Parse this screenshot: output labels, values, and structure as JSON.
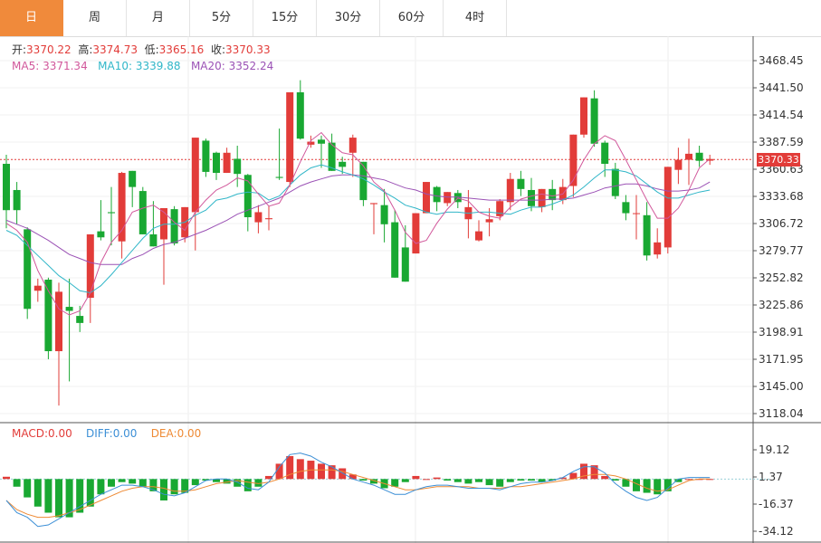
{
  "tabs": [
    "日",
    "周",
    "月",
    "5分",
    "15分",
    "30分",
    "60分",
    "4时"
  ],
  "active_tab": 0,
  "ohlc": {
    "open_label": "开:",
    "open": "3370.22",
    "high_label": "高:",
    "high": "3374.73",
    "low_label": "低:",
    "low": "3365.16",
    "close_label": "收:",
    "close": "3370.33"
  },
  "ma": {
    "ma5_label": "MA5:",
    "ma5": "3371.34",
    "ma10_label": "MA10:",
    "ma10": "3339.88",
    "ma20_label": "MA20:",
    "ma20": "3352.24"
  },
  "macd": {
    "macd_label": "MACD:",
    "macd": "0.00",
    "diff_label": "DIFF:",
    "diff": "0.00",
    "dea_label": "DEA:",
    "dea": "0.00"
  },
  "current_price": "3370.33",
  "colors": {
    "up": "#e23c39",
    "down": "#19a832",
    "ma5": "#d1589b",
    "ma10": "#30b6c8",
    "ma20": "#9b52b5",
    "diff": "#3c8fd6",
    "dea": "#ee8a34",
    "active_tab": "#f08a3b"
  },
  "chart_data": {
    "type": "candlestick",
    "y_ticks": [
      "3468.45",
      "3441.50",
      "3414.54",
      "3387.59",
      "3360.63",
      "3333.68",
      "3306.72",
      "3279.77",
      "3252.82",
      "3225.86",
      "3198.91",
      "3171.95",
      "3145.00",
      "3118.04"
    ],
    "ylim": [
      3118.04,
      3468.45
    ],
    "macd_ticks": [
      "19.12",
      "1.37",
      "-16.37",
      "-34.12"
    ],
    "macd_ylim": [
      -34.12,
      19.12
    ],
    "candles": [
      [
        3366,
        3375,
        3302,
        3320
      ],
      [
        3340,
        3348,
        3306,
        3320
      ],
      [
        3301,
        3303,
        3212,
        3222
      ],
      [
        3240,
        3252,
        3229,
        3245
      ],
      [
        3251,
        3253,
        3172,
        3180
      ],
      [
        3180,
        3248,
        3126,
        3239
      ],
      [
        3224,
        3252,
        3150,
        3220
      ],
      [
        3215,
        3225,
        3199,
        3208
      ],
      [
        3233,
        3276,
        3208,
        3296
      ],
      [
        3299,
        3330,
        3290,
        3293
      ],
      [
        3318,
        3343,
        3285,
        3317
      ],
      [
        3289,
        3358,
        3272,
        3357
      ],
      [
        3359,
        3356,
        3323,
        3343
      ],
      [
        3339,
        3343,
        3302,
        3296
      ],
      [
        3296,
        3329,
        3305,
        3284
      ],
      [
        3291,
        3319,
        3246,
        3322
      ],
      [
        3321,
        3324,
        3285,
        3287
      ],
      [
        3293,
        3317,
        3288,
        3323
      ],
      [
        3318,
        3391,
        3280,
        3392
      ],
      [
        3389,
        3391,
        3353,
        3358
      ],
      [
        3377,
        3378,
        3350,
        3357
      ],
      [
        3357,
        3382,
        3367,
        3377
      ],
      [
        3371,
        3384,
        3343,
        3356
      ],
      [
        3355,
        3356,
        3299,
        3313
      ],
      [
        3308,
        3325,
        3297,
        3318
      ],
      [
        3311,
        3324,
        3300,
        3312
      ],
      [
        3353,
        3401,
        3350,
        3352
      ],
      [
        3348,
        3415,
        3343,
        3437
      ],
      [
        3437,
        3449,
        3390,
        3391
      ],
      [
        3385,
        3394,
        3382,
        3388
      ],
      [
        3390,
        3394,
        3362,
        3386
      ],
      [
        3387,
        3396,
        3363,
        3359
      ],
      [
        3368,
        3373,
        3356,
        3363
      ],
      [
        3377,
        3395,
        3353,
        3392
      ],
      [
        3368,
        3366,
        3324,
        3330
      ],
      [
        3326,
        3326,
        3296,
        3327
      ],
      [
        3325,
        3341,
        3288,
        3306
      ],
      [
        3308,
        3320,
        3277,
        3253
      ],
      [
        3283,
        3305,
        3269,
        3249
      ],
      [
        3277,
        3316,
        3298,
        3317
      ],
      [
        3317,
        3342,
        3337,
        3348
      ],
      [
        3343,
        3344,
        3319,
        3328
      ],
      [
        3327,
        3336,
        3324,
        3338
      ],
      [
        3337,
        3340,
        3322,
        3328
      ],
      [
        3311,
        3340,
        3292,
        3323
      ],
      [
        3290,
        3310,
        3289,
        3299
      ],
      [
        3308,
        3322,
        3294,
        3311
      ],
      [
        3314,
        3331,
        3310,
        3329
      ],
      [
        3328,
        3357,
        3320,
        3351
      ],
      [
        3351,
        3359,
        3334,
        3341
      ],
      [
        3340,
        3352,
        3319,
        3324
      ],
      [
        3323,
        3339,
        3318,
        3341
      ],
      [
        3341,
        3350,
        3320,
        3330
      ],
      [
        3330,
        3351,
        3326,
        3343
      ],
      [
        3344,
        3378,
        3333,
        3395
      ],
      [
        3395,
        3431,
        3392,
        3432
      ],
      [
        3431,
        3439,
        3383,
        3386
      ],
      [
        3387,
        3389,
        3353,
        3366
      ],
      [
        3361,
        3367,
        3331,
        3334
      ],
      [
        3328,
        3335,
        3310,
        3317
      ],
      [
        3317,
        3335,
        3291,
        3317
      ],
      [
        3315,
        3328,
        3270,
        3275
      ],
      [
        3276,
        3302,
        3272,
        3288
      ],
      [
        3283,
        3358,
        3277,
        3363
      ],
      [
        3360,
        3382,
        3346,
        3370
      ],
      [
        3370,
        3391,
        3345,
        3376
      ],
      [
        3377,
        3384,
        3363,
        3369
      ],
      [
        3370,
        3375,
        3365,
        3370
      ]
    ],
    "ma5": [
      3307,
      3300,
      3288,
      3260,
      3240,
      3222,
      3216,
      3220,
      3238,
      3268,
      3288,
      3300,
      3318,
      3322,
      3325,
      3318,
      3308,
      3300,
      3318,
      3330,
      3340,
      3345,
      3352,
      3349,
      3336,
      3324,
      3327,
      3345,
      3368,
      3389,
      3397,
      3385,
      3377,
      3375,
      3364,
      3348,
      3339,
      3320,
      3298,
      3287,
      3290,
      3307,
      3321,
      3332,
      3329,
      3318,
      3314,
      3312,
      3323,
      3331,
      3334,
      3336,
      3334,
      3336,
      3350,
      3370,
      3386,
      3394,
      3389,
      3370,
      3350,
      3330,
      3312,
      3312,
      3322,
      3340,
      3362,
      3371
    ],
    "ma10": [
      3300,
      3295,
      3285,
      3275,
      3265,
      3255,
      3248,
      3240,
      3238,
      3245,
      3256,
      3268,
      3280,
      3292,
      3302,
      3306,
      3306,
      3308,
      3315,
      3320,
      3330,
      3332,
      3336,
      3338,
      3337,
      3330,
      3334,
      3345,
      3355,
      3362,
      3365,
      3362,
      3358,
      3355,
      3351,
      3345,
      3338,
      3332,
      3325,
      3322,
      3318,
      3316,
      3318,
      3318,
      3317,
      3318,
      3318,
      3317,
      3316,
      3320,
      3323,
      3323,
      3326,
      3330,
      3335,
      3343,
      3352,
      3360,
      3360,
      3358,
      3354,
      3346,
      3338,
      3332,
      3332,
      3335,
      3338,
      3340
    ],
    "ma20": [
      3310,
      3306,
      3302,
      3296,
      3290,
      3283,
      3276,
      3272,
      3268,
      3266,
      3266,
      3266,
      3272,
      3276,
      3282,
      3286,
      3288,
      3292,
      3296,
      3300,
      3305,
      3310,
      3316,
      3320,
      3324,
      3328,
      3332,
      3338,
      3344,
      3348,
      3351,
      3354,
      3355,
      3355,
      3354,
      3352,
      3350,
      3346,
      3342,
      3340,
      3336,
      3334,
      3333,
      3333,
      3332,
      3331,
      3330,
      3330,
      3330,
      3330,
      3330,
      3330,
      3331,
      3331,
      3332,
      3335,
      3338,
      3342,
      3344,
      3346,
      3346,
      3344,
      3341,
      3339,
      3339,
      3340,
      3342,
      3348
    ],
    "macd_hist": [
      1.5,
      -5,
      -12,
      -18,
      -22,
      -25,
      -25,
      -22,
      -18,
      -10,
      -5,
      -2,
      -3,
      -5,
      -8,
      -14,
      -10,
      -9,
      -4,
      -1,
      -2,
      -3,
      -5,
      -8,
      -5,
      2,
      10,
      15,
      13,
      12,
      10,
      9,
      7,
      3,
      -1,
      -3,
      -6,
      -5,
      -2,
      2,
      0,
      1,
      -1,
      -2,
      -3,
      -2,
      -4,
      -5,
      -2,
      -1,
      -1,
      -2,
      -1,
      1,
      4,
      10,
      9,
      2,
      -1,
      -5,
      -8,
      -9,
      -10,
      -8,
      -2,
      0,
      0,
      0
    ],
    "diff": [
      -14,
      -22,
      -25,
      -31,
      -30,
      -26,
      -22,
      -18,
      -14,
      -10,
      -7,
      -4,
      -4,
      -5,
      -7,
      -10,
      -11,
      -9,
      -5,
      -1,
      0,
      0,
      -2,
      -6,
      -7,
      -2,
      8,
      16,
      17,
      15,
      11,
      8,
      4,
      0,
      -2,
      -4,
      -7,
      -10,
      -10,
      -7,
      -5,
      -4,
      -4,
      -5,
      -6,
      -6,
      -6,
      -7,
      -5,
      -3,
      -2,
      -2,
      -1,
      1,
      5,
      8,
      8,
      4,
      -3,
      -8,
      -12,
      -14,
      -12,
      -6,
      0,
      1,
      1,
      1
    ],
    "dea": [
      -14,
      -20,
      -23,
      -25,
      -25,
      -24,
      -22,
      -20,
      -17,
      -14,
      -11,
      -8,
      -6,
      -5,
      -5,
      -6,
      -8,
      -8,
      -7,
      -5,
      -3,
      -2,
      -1,
      -2,
      -3,
      -2,
      0,
      3,
      5,
      6,
      6,
      6,
      5,
      3,
      1,
      -1,
      -3,
      -5,
      -7,
      -7,
      -6,
      -5,
      -5,
      -5,
      -5,
      -6,
      -6,
      -6,
      -5,
      -5,
      -4,
      -3,
      -2,
      -1,
      0,
      2,
      3,
      3,
      2,
      0,
      -3,
      -6,
      -8,
      -7,
      -4,
      -1,
      0,
      0
    ]
  }
}
